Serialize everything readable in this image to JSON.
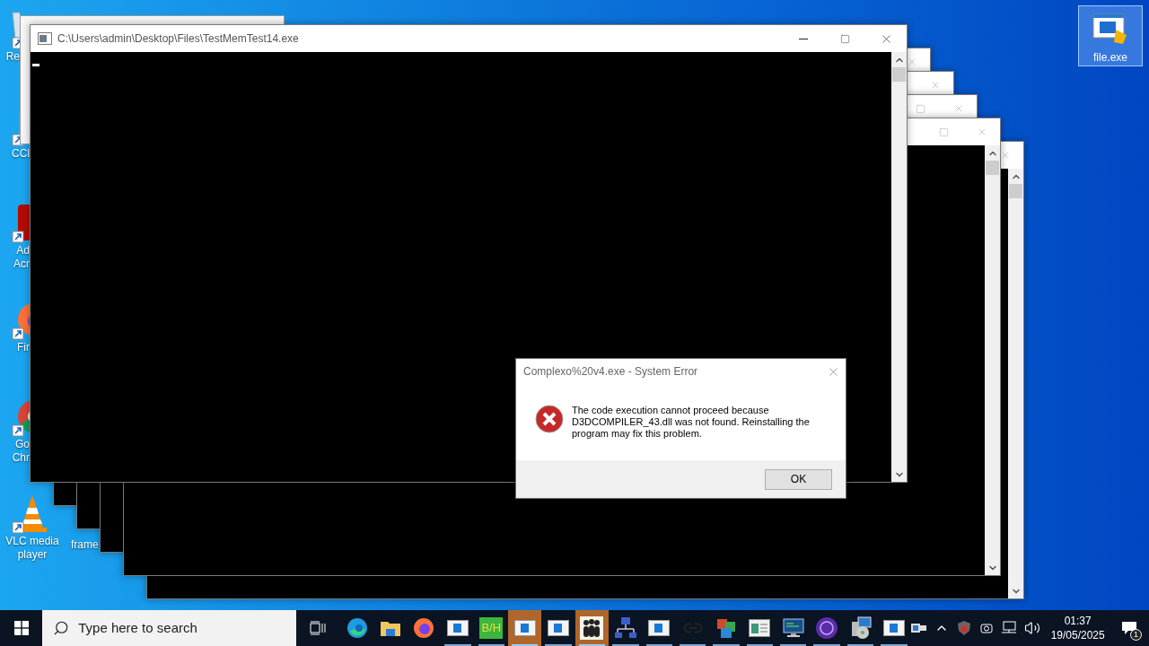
{
  "desktop_icons": [
    {
      "kind": "recycle-bin",
      "label": [
        "Re"
      ]
    },
    {
      "kind": "shortcut",
      "label": [
        "CCl"
      ]
    },
    {
      "kind": "acrobat",
      "label": [
        "Ad",
        "Acr"
      ]
    },
    {
      "kind": "firefox",
      "label": [
        "Fir"
      ]
    },
    {
      "kind": "chrome",
      "label": [
        "Go",
        "Chr"
      ]
    },
    {
      "kind": "vlc",
      "label": [
        "VLC media",
        "player"
      ]
    }
  ],
  "hidden_icon_label": "frame",
  "file_icon": {
    "label": "file.exe",
    "selected": true
  },
  "background_windows": [
    {
      "controls": [
        {
          "kind": "close"
        }
      ]
    },
    {
      "controls": [
        {
          "kind": "close"
        }
      ]
    },
    {
      "controls": [
        {
          "kind": "maximize"
        },
        {
          "kind": "close"
        }
      ]
    },
    {
      "controls": [
        {
          "kind": "maximize"
        },
        {
          "kind": "close"
        }
      ]
    },
    {
      "controls": [
        {
          "kind": "close"
        }
      ]
    }
  ],
  "console_window": {
    "title": "C:\\Users\\admin\\Desktop\\Files\\TestMemTest14.exe",
    "controls": [
      {
        "kind": "minimize"
      },
      {
        "kind": "maximize"
      },
      {
        "kind": "close"
      }
    ]
  },
  "error_dialog": {
    "title": "Complexo%20v4.exe - System Error",
    "message": "The code execution cannot proceed because D3DCOMPILER_43.dll was not found. Reinstalling the program may fix this problem.",
    "button": "OK"
  },
  "taskbar": {
    "search": {
      "placeholder": "Type here to search"
    },
    "apps": [
      {
        "kind": "edge",
        "running": false,
        "selected": false
      },
      {
        "kind": "folder",
        "running": false,
        "selected": false
      },
      {
        "kind": "firefox",
        "running": false,
        "selected": false
      },
      {
        "kind": "window",
        "running": true,
        "selected": false
      },
      {
        "kind": "text",
        "text": "B/H",
        "running": true,
        "selected": false
      },
      {
        "kind": "window",
        "running": true,
        "selected": true
      },
      {
        "kind": "window",
        "running": true,
        "selected": false
      },
      {
        "kind": "people",
        "running": true,
        "selected": true
      },
      {
        "kind": "network",
        "running": true,
        "selected": false
      },
      {
        "kind": "window",
        "running": true,
        "selected": false
      },
      {
        "kind": "link",
        "running": true,
        "selected": false
      },
      {
        "kind": "cubes",
        "running": true,
        "selected": false
      },
      {
        "kind": "form",
        "running": true,
        "selected": false
      },
      {
        "kind": "monitor",
        "running": true,
        "selected": false
      },
      {
        "kind": "orb",
        "running": true,
        "selected": false
      },
      {
        "kind": "installer",
        "running": true,
        "selected": false
      },
      {
        "kind": "window",
        "running": true,
        "selected": false
      }
    ],
    "tray": [
      {
        "kind": "usb"
      },
      {
        "kind": "chevron"
      },
      {
        "kind": "shield"
      },
      {
        "kind": "camera"
      },
      {
        "kind": "network"
      },
      {
        "kind": "volume"
      }
    ],
    "time": "01:37",
    "date": "19/05/2025",
    "notifications": "1"
  }
}
